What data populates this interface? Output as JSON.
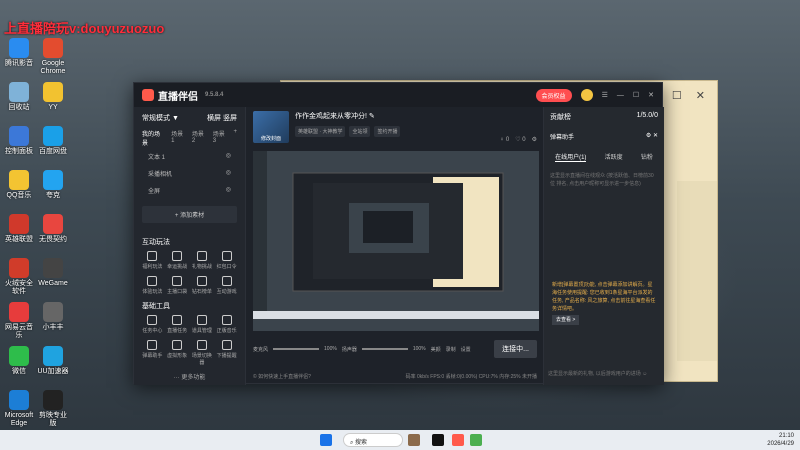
{
  "watermark": "上直播陪玩v:douyuzuozuo",
  "desktop_icons": [
    "腾讯影音",
    "Google Chrome",
    "回收站",
    "YY",
    "控制面板",
    "百度网盘",
    "QQ音乐",
    "夸克",
    "英雄联盟",
    "无畏契约",
    "火绒安全软件",
    "WeGame",
    "网易云音乐",
    "小丰丰",
    "微信",
    "UU加速器",
    "Microsoft Edge",
    "剪映专业版"
  ],
  "back_window": {
    "min": "—",
    "max": "☐",
    "close": "✕"
  },
  "app": {
    "title": "直播伴侣",
    "version": "9.5.8.4",
    "member_btn": "会员权益",
    "open_pipe": "开播直播",
    "menu": "☰",
    "left": {
      "mode": "常规模式 ▼",
      "orient": "横屏  竖屏",
      "my_scenes": "我的场景",
      "scene_tabs": [
        "场景1",
        "场景2",
        "场景3"
      ],
      "add": "+",
      "sources": [
        "文本 1",
        "采播相机",
        "全屏"
      ],
      "add_source": "+ 添加素材",
      "interact": "互动玩法",
      "interact_tools": [
        "福利玩法",
        "幸运挑战",
        "礼物挑战",
        "红包口令",
        "体验玩法",
        "主播口袋",
        "钻石榜单",
        "互动游戏"
      ],
      "basic": "基础工具",
      "basic_tools": [
        "任务中心",
        "直播任务",
        "道具管理",
        "正版音乐",
        "弹幕助手",
        "虚拟形象",
        "场景切换器",
        "下播提醒"
      ],
      "more": "··· 更多功能"
    },
    "center": {
      "cover_label": "修改封面",
      "stream_title": "作作金鸡起来从零冲分! ✎",
      "tags": [
        "英雄联盟 · 大神教学",
        "全站领",
        "签约开播"
      ],
      "stats": [
        "♀ 0",
        "♡ 0",
        "⚙"
      ],
      "mic_label": "麦克风",
      "mic_val": "100%",
      "speaker_label": "扬声器",
      "speaker_val": "100%",
      "beauty": "美颜",
      "record": "录制",
      "settings": "设置",
      "live_btn": "连接中...",
      "status_left": "© 如何快速上手直播伴侣?",
      "status_right": "码率 0kb/s   FPS:0   丢帧:0(0.00%)   CPU:7%   内存:25%   未开播"
    },
    "right": {
      "tab_top": "贡献榜",
      "tab_top_val": "1/5.0/0",
      "danmu": "弹幕助手",
      "tabs": [
        "在线用户(1)",
        "活跃度",
        "钻粉"
      ],
      "tip": "这里显示直播间在线观众 (按活跃值、日榜前30位 排名, 点击用户昵称可显示进一步信息)",
      "notice": "新增[弹幕置顶]功能, 点击弹幕添加讲解页。星海任务使用提醒: 您已收到1条星海平台派发的任务, 产品名称: 风之旅算, 点击前往星海查看任务详情吧。",
      "notice_btn": "去查看 >",
      "input_tip": "这里显示最新的礼物, 以后游戏用户的进场 ☺"
    }
  },
  "taskbar": {
    "search": "搜索",
    "time": "21:10",
    "date": "2026/4/29"
  }
}
